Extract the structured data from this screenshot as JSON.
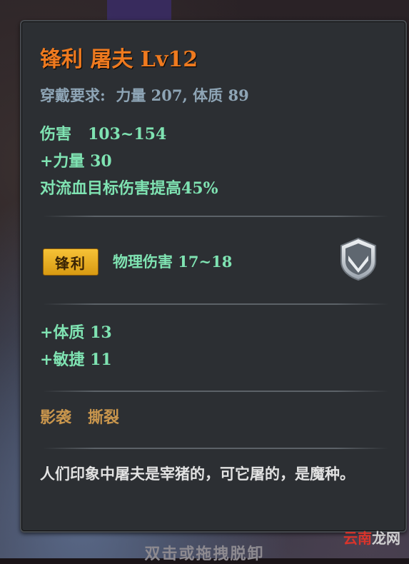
{
  "item": {
    "title": "锋利 屠夫 Lv12",
    "requirement": "穿戴要求:  力量 207, 体质 89",
    "damage": "伤害   103~154",
    "strength_bonus": "+力量 30",
    "bleed_bonus": "对流血目标伤害提高45%",
    "affix_badge": "锋利",
    "affix_effect": "物理伤害 17~18",
    "constitution_bonus": "+体质 13",
    "agility_bonus": "+敏捷 11",
    "skills": "影袭   撕裂",
    "description": "人们印象中屠夫是宰猪的，可它屠的，是魔种。",
    "badge_icon": "shield-icon"
  },
  "hint": "双击或拖拽脱卸",
  "watermark": {
    "red_part": "云南",
    "grey_part": "龙网"
  },
  "colors": {
    "title": "#ef7a1f",
    "requirement": "#8ea5b6",
    "stat": "#7fe3b2",
    "skill": "#c9964d",
    "description": "#e2e2e2",
    "badge": "#f0b62a"
  }
}
